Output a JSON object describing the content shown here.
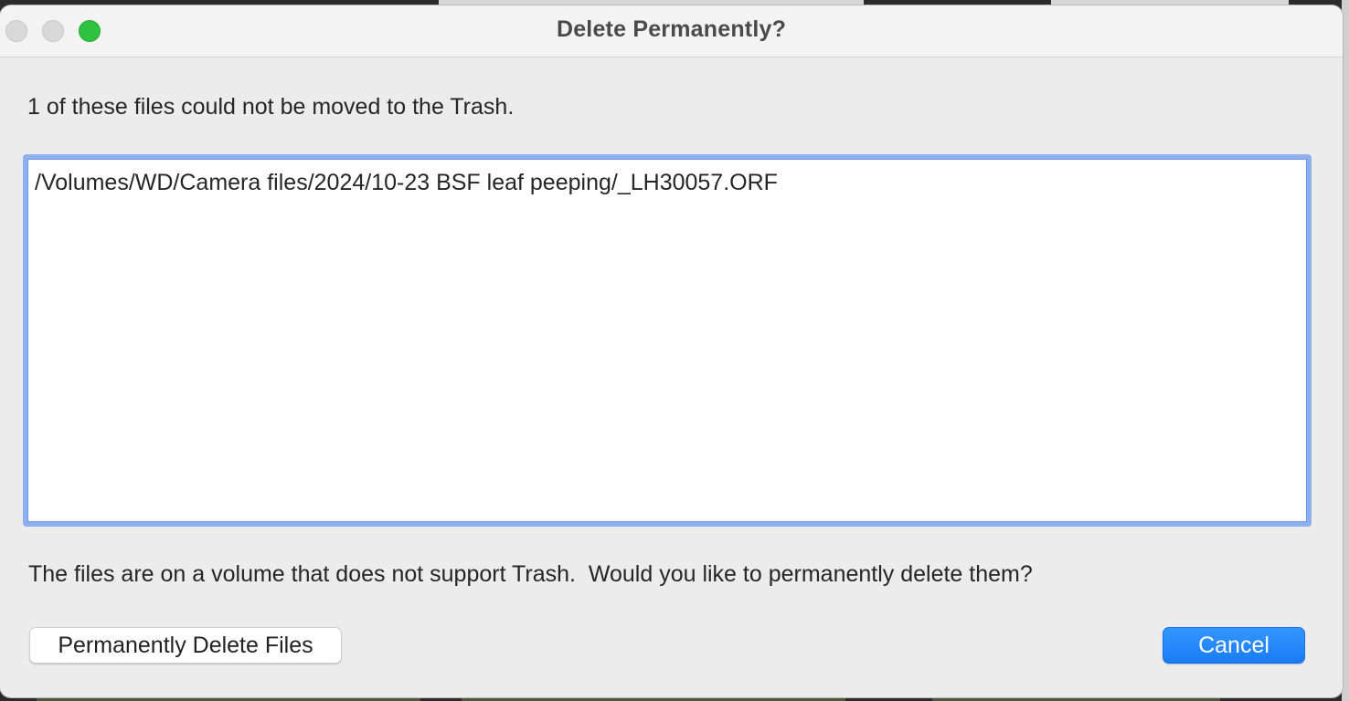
{
  "dialog": {
    "title": "Delete Permanently?",
    "message": "1 of these files could not be moved to the Trash.",
    "files": [
      "/Volumes/WD/Camera files/2024/10-23 BSF leaf peeping/_LH30057.ORF"
    ],
    "question": "The files are on a volume that does not support Trash.  Would you like to permanently delete them?",
    "buttons": {
      "delete_label": "Permanently Delete Files",
      "cancel_label": "Cancel"
    }
  },
  "colors": {
    "accent": "#1a7cf5",
    "focus_ring": "#8eaff0",
    "zoom_button": "#2ec23f"
  },
  "icons": {
    "close": "window-close-icon",
    "minimize": "window-minimize-icon",
    "zoom": "window-zoom-icon"
  }
}
